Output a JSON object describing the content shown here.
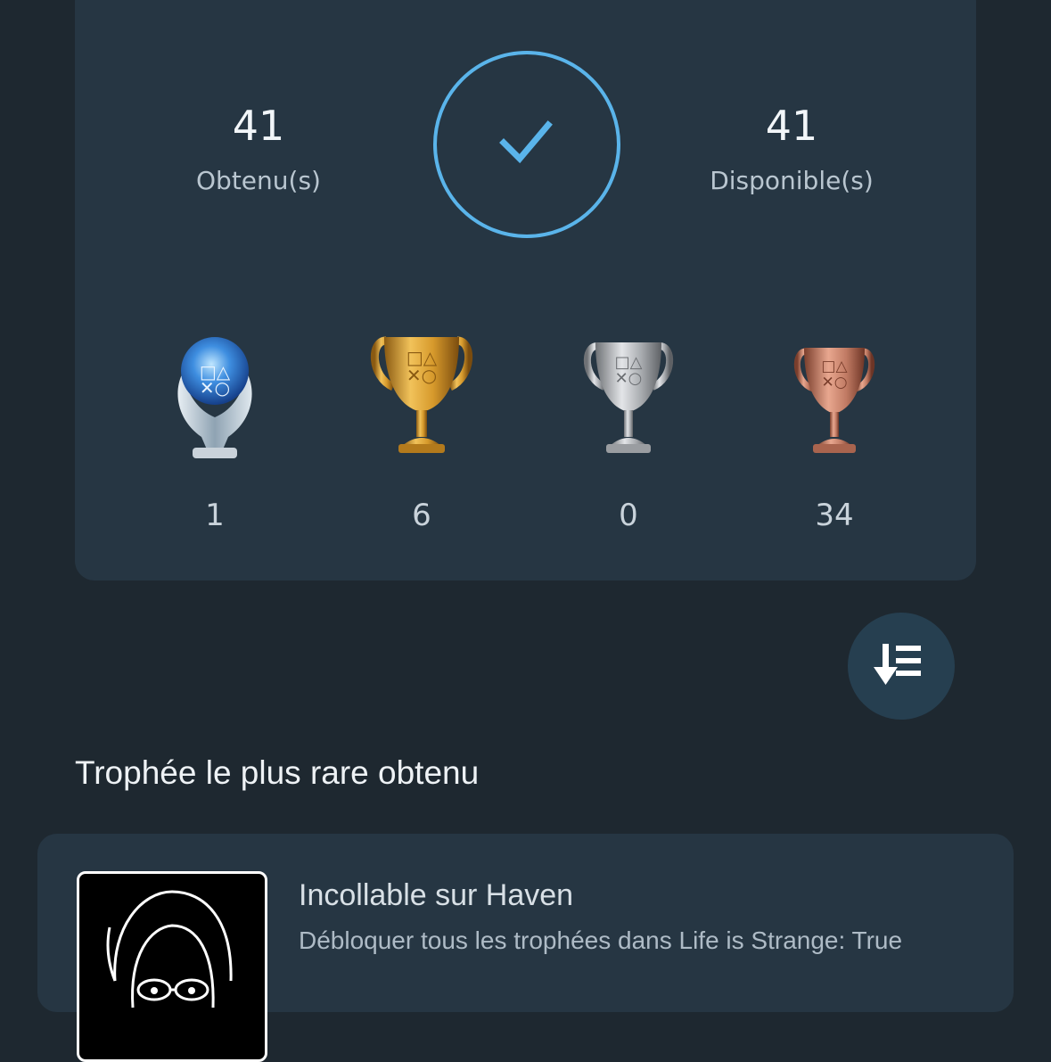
{
  "summary": {
    "earned": {
      "value": "41",
      "label": "Obtenu(s)"
    },
    "available": {
      "value": "41",
      "label": "Disponible(s)"
    },
    "completion_fraction": 1.0
  },
  "trophies": [
    {
      "type": "platinum",
      "count": "1"
    },
    {
      "type": "gold",
      "count": "6"
    },
    {
      "type": "silver",
      "count": "0"
    },
    {
      "type": "bronze",
      "count": "34"
    }
  ],
  "sort": {
    "icon": "sort-descending-icon"
  },
  "rarest": {
    "section_title": "Trophée le plus rare obtenu",
    "title": "Incollable sur Haven",
    "description": "Débloquer tous les trophées dans Life is Strange: True"
  },
  "colors": {
    "accent": "#5ab4ea",
    "card": "#263643",
    "background": "#1e2830",
    "platinum": "#4a8fd8",
    "gold": "#d9a23a",
    "silver": "#b7b9bc",
    "bronze": "#c8826e"
  }
}
